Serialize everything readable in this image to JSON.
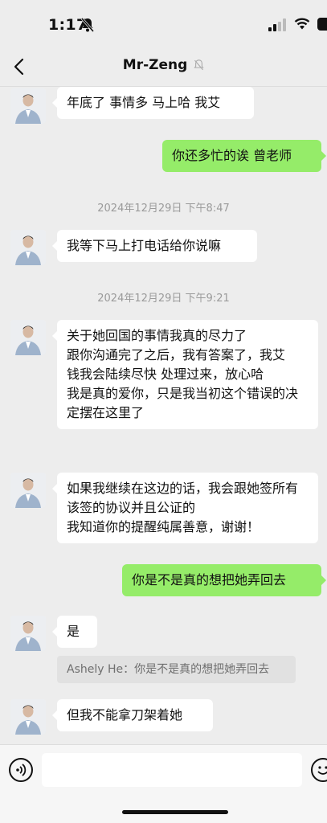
{
  "status": {
    "time": "1:17"
  },
  "header": {
    "title": "Mr-Zeng",
    "back_icon": "chevron-left-icon",
    "mute_icon": "bell-off-icon"
  },
  "messages": {
    "m1": {
      "side": "in",
      "text": "年底了 事情多 马上哈 我艾"
    },
    "m2": {
      "side": "out",
      "text": "你还多忙的诶 曾老师"
    },
    "t1": {
      "text": "2024年12月29日 下午8:47"
    },
    "m3": {
      "side": "in",
      "text": "我等下马上打电话给你说嘛"
    },
    "t2": {
      "text": "2024年12月29日 下午9:21"
    },
    "m4": {
      "side": "in",
      "text": "关于她回国的事情我真的尽力了\n跟你沟通完了之后，我有答案了，我艾\n钱我会陆续尽快 处理过来，放心哈\n我是真的爱你，只是我当初这个错误的决定摆在这里了"
    },
    "m5": {
      "side": "in",
      "text": "如果我继续在这边的话，我会跟她签所有该签的协议并且公证的\n我知道你的提醒纯属善意，谢谢！"
    },
    "m6": {
      "side": "out",
      "text": "你是不是真的想把她弄回去"
    },
    "m7": {
      "side": "in",
      "text": "是"
    },
    "q1": {
      "text": "Ashely He：你是不是真的想把她弄回去"
    },
    "m8": {
      "side": "in",
      "text": "但我不能拿刀架着她"
    }
  },
  "input": {
    "value": "",
    "placeholder": ""
  },
  "colors": {
    "outgoing": "#95ec69",
    "incoming": "#ffffff",
    "background": "#ededed"
  }
}
